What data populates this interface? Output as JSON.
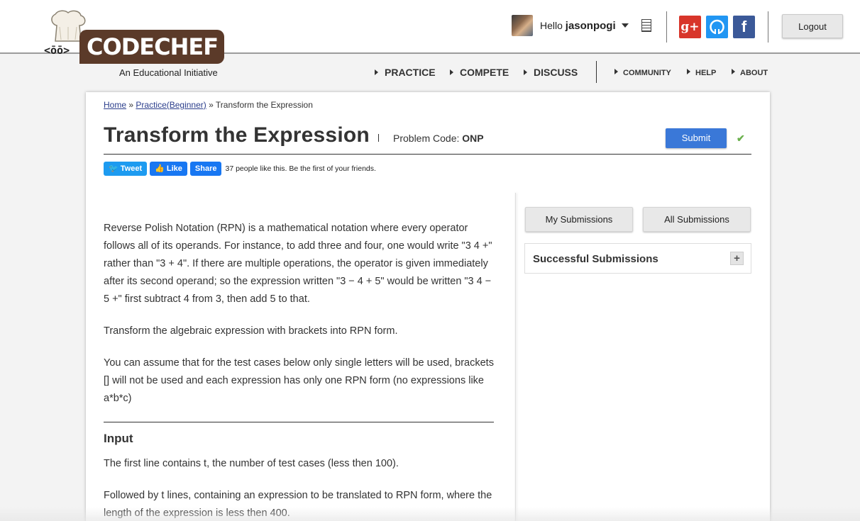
{
  "brand": {
    "name": "CODECHEF",
    "tagline": "An Educational Initiative",
    "face": "<ōō>"
  },
  "user": {
    "greeting": "Hello",
    "username": "jasonpogi"
  },
  "social": {
    "gplus": "g+",
    "github": "◯",
    "facebook": "f"
  },
  "logout_label": "Logout",
  "nav": {
    "main": [
      "PRACTICE",
      "COMPETE",
      "DISCUSS"
    ],
    "sub": [
      "COMMUNITY",
      "HELP",
      "ABOUT"
    ]
  },
  "breadcrumb": {
    "home": "Home",
    "sep": "»",
    "practice": "Practice(Beginner)",
    "current": "Transform the Expression"
  },
  "problem": {
    "title": "Transform the Expression",
    "code_label": "Problem Code:",
    "code": "ONP",
    "submit_label": "Submit",
    "check": "✔"
  },
  "share": {
    "tweet": "Tweet",
    "like": "Like",
    "share": "Share",
    "like_text": "37 people like this. Be the first of your friends."
  },
  "statement": [
    "Reverse Polish Notation (RPN) is a mathematical notation where every operator follows all of its operands. For instance, to add three and four, one would write \"3 4 +\" rather than \"3 + 4\". If there are multiple operations, the operator is given immediately after its second operand; so the expression written \"3 − 4 + 5\" would be written \"3 4 − 5 +\" first subtract 4 from 3, then add 5 to that.",
    "Transform the algebraic expression with brackets into RPN form.",
    "You can assume that for the test cases below only single letters will be used, brackets [] will not be used and each expression has only one RPN form (no expressions like a*b*c)"
  ],
  "input": {
    "heading": "Input",
    "p1": "The first line contains t, the number of test cases (less then 100).",
    "p2": "Followed by t lines, containing an expression to be translated to RPN form, where the length of the expression is less then 400."
  },
  "sidebar": {
    "my_submissions": "My Submissions",
    "all_submissions": "All Submissions",
    "successful": "Successful Submissions",
    "expand": "+"
  }
}
